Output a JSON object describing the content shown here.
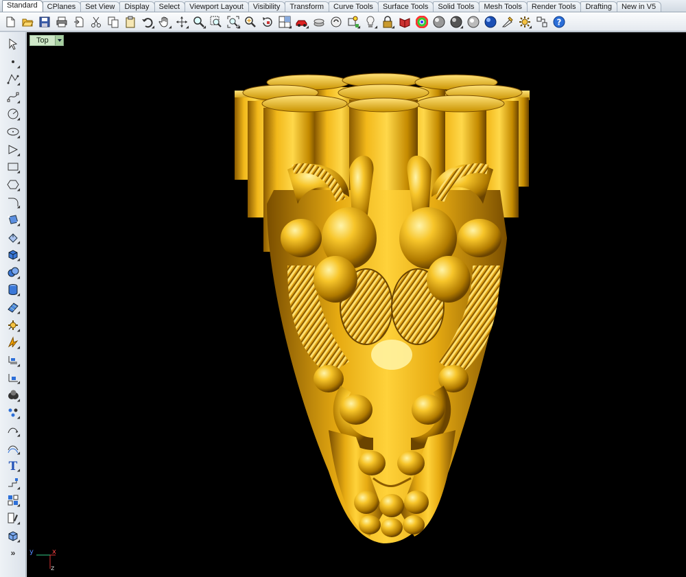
{
  "tabs": [
    {
      "label": "Standard",
      "active": true
    },
    {
      "label": "CPlanes"
    },
    {
      "label": "Set View"
    },
    {
      "label": "Display"
    },
    {
      "label": "Select"
    },
    {
      "label": "Viewport Layout"
    },
    {
      "label": "Visibility"
    },
    {
      "label": "Transform"
    },
    {
      "label": "Curve Tools"
    },
    {
      "label": "Surface Tools"
    },
    {
      "label": "Solid Tools"
    },
    {
      "label": "Mesh Tools"
    },
    {
      "label": "Render Tools"
    },
    {
      "label": "Drafting"
    },
    {
      "label": "New in V5"
    }
  ],
  "toolbar_icons": [
    "new-file-icon",
    "open-file-icon",
    "save-icon",
    "print-icon",
    "import-icon",
    "cut-icon",
    "copy-icon",
    "paste-icon",
    "undo-icon",
    "pan-hand-icon",
    "rotate-view-icon",
    "zoom-icon",
    "zoom-window-icon",
    "zoom-extents-icon",
    "zoom-selected-icon",
    "undo-view-icon",
    "four-viewports-icon",
    "car-icon",
    "layer-icon",
    "object-properties-icon",
    "osnap-icon",
    "light-bulb-icon",
    "lock-icon",
    "material-icon",
    "color-wheel-icon",
    "render-sphere-icon",
    "shaded-sphere-icon",
    "ghosted-sphere-icon",
    "render-globe-icon",
    "tool-options-icon",
    "gear-settings-icon",
    "grid-snap-icon",
    "help-icon"
  ],
  "left_tool_icons": [
    "select-arrow-icon",
    "point-icon",
    "polyline-icon",
    "curve-icon",
    "circle-icon",
    "ellipse-icon",
    "polygon-icon",
    "rectangle-icon",
    "hexagon-icon",
    "fillet-curve-icon",
    "surface-control-points-icon",
    "extrude-surface-icon",
    "box-solid-icon",
    "boolean-spheres-icon",
    "cylinder-solid-icon",
    "plane-surface-icon",
    "mesh-gear-icon",
    "lightning-render-icon",
    "dimension-icon",
    "dimension-angle-icon",
    "boolean-union-icon",
    "points-group-icon",
    "curve-edit-icon",
    "offset-curve-icon",
    "text-icon",
    "align-icon",
    "group-icon",
    "analyze-icon",
    "block-icon"
  ],
  "left_more_label": "»",
  "viewport": {
    "title": "Top",
    "axis_x": "x",
    "axis_y": "y",
    "axis_z": "z"
  },
  "colors": {
    "gold": "#f5c022",
    "gold_dark": "#8a5a00",
    "gold_light": "#ffe680",
    "viewport_bg": "#000000",
    "title_tab": "#cfe8c8"
  }
}
